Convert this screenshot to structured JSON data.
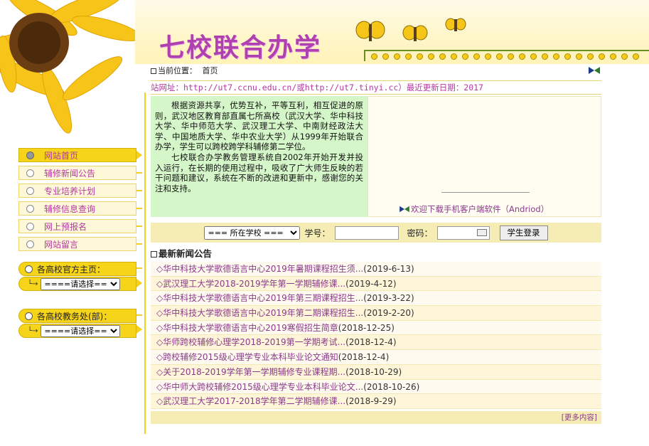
{
  "header": {
    "site_title": "七校联合办学"
  },
  "breadcrumb": {
    "label": "当前位置：",
    "current": "首页"
  },
  "url_line": "站网址：http://ut7.ccnu.edu.cn/或http://ut7.tinyi.cc）最近更新日期：2017",
  "intro": {
    "p1": "根据资源共享，优势互补，平等互利，相互促进的原则，武汉地区教育部直属七所高校（武汉大学、华中科技大学、华中师范大学、武汉理工大学、中南财经政法大学、中国地质大学、华中农业大学）从1999年开始联合办学，学生可以跨校跨学科辅修第二学位。",
    "p2": "七校联合办学教务管理系统自2002年开始开发并投入运行，在长期的使用过程中，吸收了广大师生反映的若干问题和建议，系统在不断的改进和更新中，感谢您的关注和支持。"
  },
  "download_link": "欢迎下载手机客户端软件（Andriod）",
  "nav": [
    {
      "label": "网站首页",
      "active": true
    },
    {
      "label": "辅修新闻公告",
      "active": false
    },
    {
      "label": "专业培养计划",
      "active": false
    },
    {
      "label": "辅修信息查询",
      "active": false
    },
    {
      "label": "网上预报名",
      "active": false
    },
    {
      "label": "网站留言",
      "active": false
    }
  ],
  "school_home": {
    "label": "各高校官方主页：",
    "select": "====请选择===="
  },
  "school_office": {
    "label": "各高校教务处(部)：",
    "select": "====请选择===="
  },
  "login": {
    "school_select": "=== 所在学校 ===",
    "student_id_label": "学号：",
    "password_label": "密码：",
    "button": "学生登录"
  },
  "news": {
    "heading": "最新新闻公告",
    "items": [
      {
        "title": "◇华中科技大学歌德语言中心2019年暑期课程招生须...",
        "date": "(2019-6-13)"
      },
      {
        "title": "◇武汉理工大学2018-2019学年第一学期辅修课...",
        "date": "(2019-4-12)"
      },
      {
        "title": "◇华中科技大学歌德语言中心2019年第三期课程招生...",
        "date": "(2019-3-22)"
      },
      {
        "title": "◇华中科技大学歌德语言中心2019年第二期课程招生...",
        "date": "(2019-2-20)"
      },
      {
        "title": "◇华中科技大学歌德语言中心2019寒假招生简章",
        "date": "(2018-12-25)"
      },
      {
        "title": "◇华师跨校辅修心理学2018-2019第一学期考试...",
        "date": "(2018-12-4)"
      },
      {
        "title": "◇跨校辅修2015级心理学专业本科毕业论文通知",
        "date": "(2018-12-4)"
      },
      {
        "title": "◇关于2018-2019学年第一学期辅修专业课程期...",
        "date": "(2018-10-29)"
      },
      {
        "title": "◇华中师大跨校辅修2015级心理学专业本科毕业论文...",
        "date": "(2018-10-26)"
      },
      {
        "title": "◇武汉理工大学2017-2018学年第二学期辅修课...",
        "date": "(2018-9-29)"
      }
    ],
    "more": "[更多内容]"
  },
  "colors": {
    "accent_yellow": "#f6d41a",
    "purple_text": "#b33aa0",
    "intro_bg": "#d5f6c9"
  }
}
